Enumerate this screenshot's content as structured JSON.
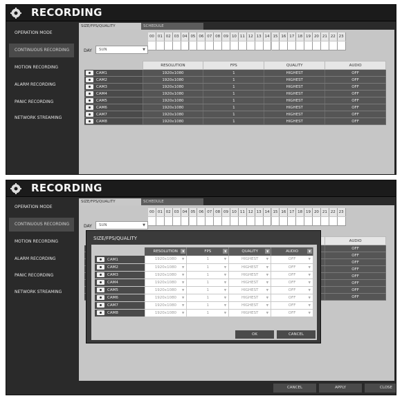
{
  "header": {
    "title": "RECORDING",
    "icon": "gear-icon"
  },
  "sidebar": {
    "items": [
      {
        "label": "OPERATION MODE",
        "active": false
      },
      {
        "label": "CONTINUOUS RECORDING",
        "active": true
      },
      {
        "label": "MOTION RECORDING",
        "active": false
      },
      {
        "label": "ALARM RECORDING",
        "active": false
      },
      {
        "label": "PANIC RECORDING",
        "active": false
      },
      {
        "label": "NETWORK STREAMING",
        "active": false
      }
    ]
  },
  "tabs": [
    {
      "label": "SIZE/FPS/QUALITY",
      "active": true
    },
    {
      "label": "SCHEDULE",
      "active": false
    }
  ],
  "day": {
    "label": "DAY",
    "value": "SUN"
  },
  "hours": [
    "00",
    "01",
    "02",
    "03",
    "04",
    "05",
    "06",
    "07",
    "08",
    "09",
    "10",
    "11",
    "12",
    "13",
    "14",
    "15",
    "16",
    "17",
    "18",
    "19",
    "20",
    "21",
    "22",
    "23"
  ],
  "table": {
    "headers": {
      "resolution": "RESOLUTION",
      "fps": "FPS",
      "quality": "QUALITY",
      "audio": "AUDIO"
    },
    "rows": [
      {
        "cam": "CAM1",
        "resolution": "1920x1080",
        "fps": "1",
        "quality": "HIGHEST",
        "audio": "OFF"
      },
      {
        "cam": "CAM2",
        "resolution": "1920x1080",
        "fps": "1",
        "quality": "HIGHEST",
        "audio": "OFF"
      },
      {
        "cam": "CAM3",
        "resolution": "1920x1080",
        "fps": "1",
        "quality": "HIGHEST",
        "audio": "OFF"
      },
      {
        "cam": "CAM4",
        "resolution": "1920x1080",
        "fps": "1",
        "quality": "HIGHEST",
        "audio": "OFF"
      },
      {
        "cam": "CAM5",
        "resolution": "1920x1080",
        "fps": "1",
        "quality": "HIGHEST",
        "audio": "OFF"
      },
      {
        "cam": "CAM6",
        "resolution": "1920x1080",
        "fps": "1",
        "quality": "HIGHEST",
        "audio": "OFF"
      },
      {
        "cam": "CAM7",
        "resolution": "1920x1080",
        "fps": "1",
        "quality": "HIGHEST",
        "audio": "OFF"
      },
      {
        "cam": "CAM8",
        "resolution": "1920x1080",
        "fps": "1",
        "quality": "HIGHEST",
        "audio": "OFF"
      }
    ]
  },
  "modal": {
    "title": "SIZE/FPS/QUALITY",
    "headers": {
      "resolution": "RESOLUTION",
      "fps": "FPS",
      "quality": "QUALITY",
      "audio": "AUDIO"
    },
    "ok_label": "OK",
    "cancel_label": "CANCEL"
  },
  "footer": {
    "cancel_label": "CANCEL",
    "apply_label": "APPLY",
    "close_label": "CLOSE"
  }
}
